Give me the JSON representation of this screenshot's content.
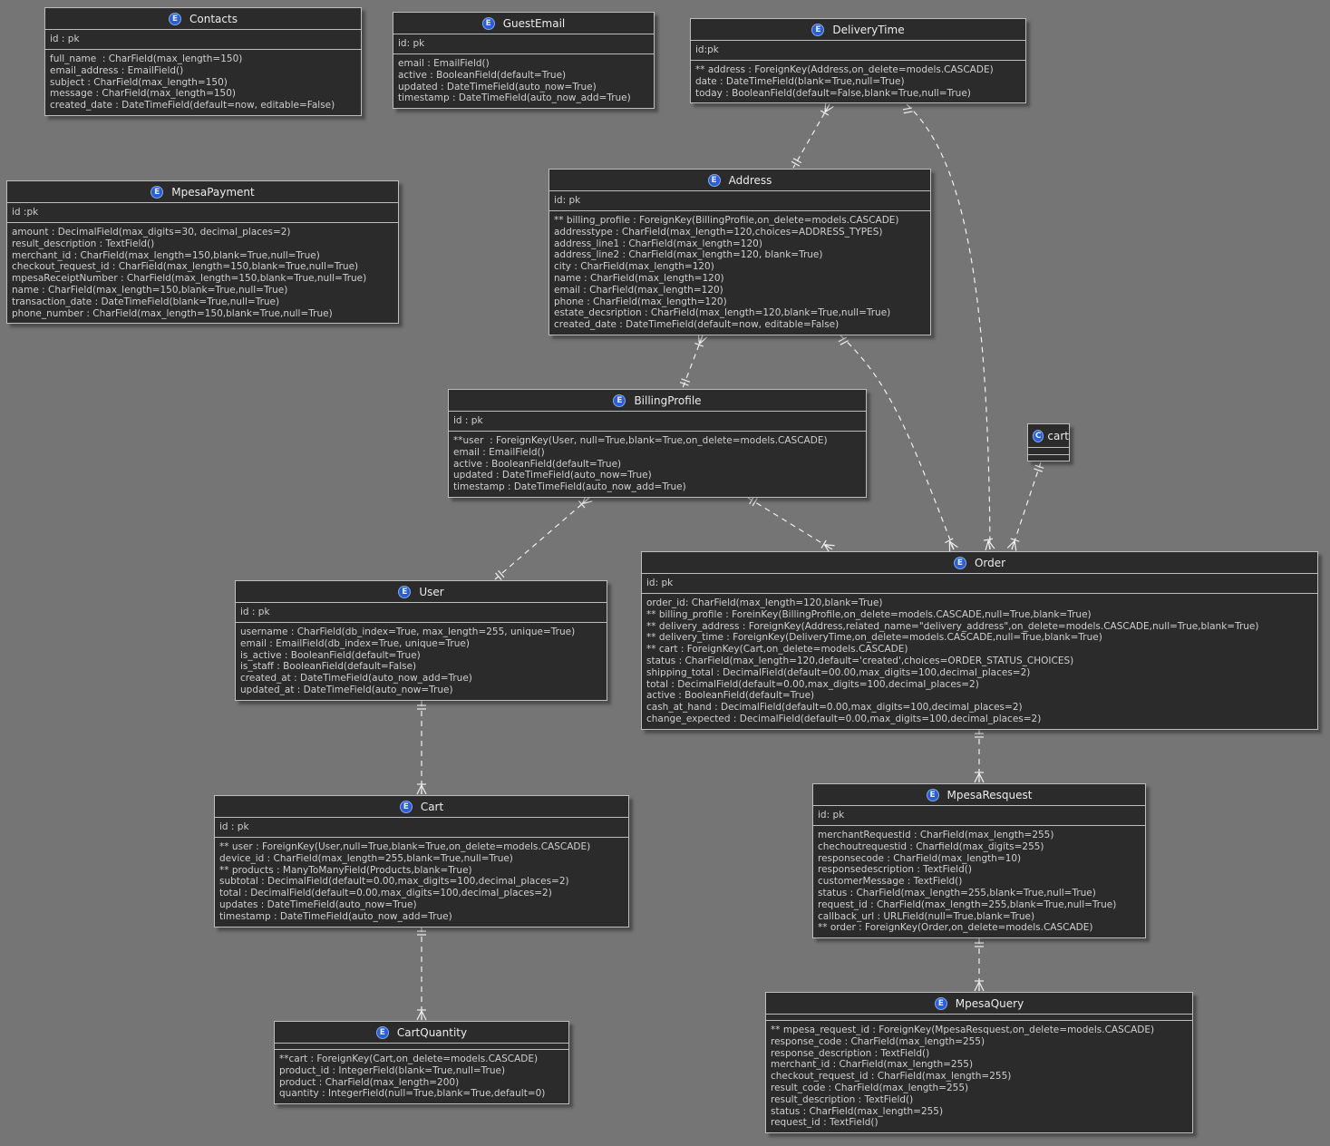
{
  "entities": {
    "contacts": {
      "name": "Contacts",
      "pk": "id : pk",
      "fields": [
        "full_name  : CharField(max_length=150)",
        "email_address : EmailField()",
        "subject : CharField(max_length=150)",
        "message : CharField(max_length=150)",
        "created_date : DateTimeField(default=now, editable=False)"
      ]
    },
    "guestemail": {
      "name": "GuestEmail",
      "pk": "id: pk",
      "fields": [
        "email : EmailField()",
        "active : BooleanField(default=True)",
        "updated : DateTimeField(auto_now=True)",
        "timestamp : DateTimeField(auto_now_add=True)"
      ]
    },
    "deliverytime": {
      "name": "DeliveryTime",
      "pk": "id:pk",
      "fields": [
        "** address : ForeignKey(Address,on_delete=models.CASCADE)",
        "date : DateTimeField(blank=True,null=True)",
        "today : BooleanField(default=False,blank=True,null=True)"
      ]
    },
    "mpesapayment": {
      "name": "MpesaPayment",
      "pk": "id :pk",
      "fields": [
        "amount : DecimalField(max_digits=30, decimal_places=2)",
        "result_description : TextField()",
        "merchant_id : CharField(max_length=150,blank=True,null=True)",
        "checkout_request_id : CharField(max_length=150,blank=True,null=True)",
        "mpesaReceiptNumber : CharField(max_length=150,blank=True,null=True)",
        "name : CharField(max_length=150,blank=True,null=True)",
        "transaction_date : DateTimeField(blank=True,null=True)",
        "phone_number : CharField(max_length=150,blank=True,null=True)"
      ]
    },
    "address": {
      "name": "Address",
      "pk": "id: pk",
      "fields": [
        "** billing_profile : ForeignKey(BillingProfile,on_delete=models.CASCADE)",
        "addresstype : CharField(max_length=120,choices=ADDRESS_TYPES)",
        "address_line1 : CharField(max_length=120)",
        "address_line2 : CharField(max_length=120, blank=True)",
        "city : CharField(max_length=120)",
        "name : CharField(max_length=120)",
        "email : CharField(max_length=120)",
        "phone : CharField(max_length=120)",
        "estate_decsription : CharField(max_length=120,blank=True,null=True)",
        "created_date : DateTimeField(default=now, editable=False)"
      ]
    },
    "billingprofile": {
      "name": "BillingProfile",
      "pk": "id : pk",
      "fields": [
        "**user  : ForeignKey(User, null=True,blank=True,on_delete=models.CASCADE)",
        "email : EmailField()",
        "active : BooleanField(default=True)",
        "updated : DateTimeField(auto_now=True)",
        "timestamp : DateTimeField(auto_now_add=True)"
      ]
    },
    "cartclass": {
      "name": "cart",
      "badge": "C"
    },
    "order": {
      "name": "Order",
      "pk": "id: pk",
      "fields": [
        "order_id: CharField(max_length=120,blank=True)",
        "** billing_profile : ForeinKey(BillingProfile,on_delete=models.CASCADE,null=True,blank=True)",
        "** delivery_address : ForeignKey(Address,related_name=\"delivery_address\",on_delete=models.CASCADE,null=True,blank=True)",
        "** delivery_time : ForeignKey(DeliveryTime,on_delete=models.CASCADE,null=True,blank=True)",
        "** cart : ForeignKey(Cart,on_delete=models.CASCADE)",
        "status : CharField(max_length=120,default='created',choices=ORDER_STATUS_CHOICES)",
        "shipping_total : DecimalField(default=00.00,max_digits=100,decimal_places=2)",
        "total : DecimalField(default=0.00,max_digits=100,decimal_places=2)",
        "active : BooleanField(default=True)",
        "cash_at_hand : DecimalField(default=0.00,max_digits=100,decimal_places=2)",
        "change_expected : DecimalField(default=0.00,max_digits=100,decimal_places=2)"
      ]
    },
    "user": {
      "name": "User",
      "pk": "id : pk",
      "fields": [
        "username : CharField(db_index=True, max_length=255, unique=True)",
        "email : EmailField(db_index=True, unique=True)",
        "is_active : BooleanField(default=True)",
        "is_staff : BooleanField(default=False)",
        "created_at : DateTimeField(auto_now_add=True)",
        "updated_at : DateTimeField(auto_now=True)"
      ]
    },
    "cart": {
      "name": "Cart",
      "pk": "id : pk",
      "fields": [
        "** user : ForeignKey(User,null=True,blank=True,on_delete=models.CASCADE)",
        "device_id : CharField(max_length=255,blank=True,null=True)",
        "** products : ManyToManyField(Products,blank=True)",
        "subtotal : DecimalField(default=0.00,max_digits=100,decimal_places=2)",
        "total : DecimalField(default=0.00,max_digits=100,decimal_places=2)",
        "updates : DateTimeField(auto_now=True)",
        "timestamp : DateTimeField(auto_now_add=True)"
      ]
    },
    "mpesaresquest": {
      "name": "MpesaResquest",
      "pk": "id: pk",
      "fields": [
        "merchantRequestid : CharField(max_length=255)",
        "chechoutrequestid : Charfield(max_digits=255)",
        "responsecode : CharField(max_length=10)",
        "responsedescription : TextField()",
        "customerMessage : TextField()",
        "status : CharField(max_length=255,blank=True,null=True)",
        "request_id : CharField(max_length=255,blank=True,null=True)",
        "callback_url : URLField(null=True,blank=True)",
        "** order : ForeignKey(Order,on_delete=models.CASCADE)"
      ]
    },
    "cartquantity": {
      "name": "CartQuantity",
      "fields": [
        "**cart : ForeignKey(Cart,on_delete=models.CASCADE)",
        "product_id : IntegerField(blank=True,null=True)",
        "product : CharField(max_length=200)",
        "quantity : IntegerField(null=True,blank=True,default=0)"
      ]
    },
    "mpesaquery": {
      "name": "MpesaQuery",
      "fields": [
        "** mpesa_request_id : ForeignKey(MpesaResquest,on_delete=models.CASCADE)",
        "response_code : CharField(max_length=255)",
        "response_description : TextField()",
        "merchant_id : CharField(max_length=255)",
        "checkout_request_id : CharField(max_length=255)",
        "result_code : CharField(max_length=255)",
        "result_description : TextField()",
        "status : CharField(max_length=255)",
        "request_id : TextField()"
      ]
    }
  },
  "relationships": [
    {
      "from": "deliverytime",
      "to": "address",
      "from_end": "one-or-many",
      "to_end": "exactly-one"
    },
    {
      "from": "deliverytime",
      "to": "order",
      "from_end": "exactly-one",
      "to_end": "one-or-many"
    },
    {
      "from": "address",
      "to": "billingprofile",
      "from_end": "one-or-many",
      "to_end": "exactly-one"
    },
    {
      "from": "address",
      "to": "order",
      "from_end": "exactly-one",
      "to_end": "one-or-many"
    },
    {
      "from": "cartclass",
      "to": "order",
      "from_end": "exactly-one",
      "to_end": "one-or-many"
    },
    {
      "from": "billingprofile",
      "to": "user",
      "from_end": "one-or-many",
      "to_end": "exactly-one"
    },
    {
      "from": "billingprofile",
      "to": "order",
      "from_end": "exactly-one",
      "to_end": "one-or-many"
    },
    {
      "from": "user",
      "to": "cart",
      "from_end": "exactly-one",
      "to_end": "one-or-many"
    },
    {
      "from": "cart",
      "to": "cartquantity",
      "from_end": "exactly-one",
      "to_end": "one-or-many"
    },
    {
      "from": "order",
      "to": "mpesaresquest",
      "from_end": "exactly-one",
      "to_end": "one-or-many"
    },
    {
      "from": "mpesaresquest",
      "to": "mpesaquery",
      "from_end": "exactly-one",
      "to_end": "one-or-many"
    }
  ],
  "entity_badge": "E",
  "colors": {
    "background": "#757575",
    "entity_fill": "#2b2b2b",
    "border": "#bdbdbd",
    "text": "#cfcfcf",
    "badge": "#2a5fd3",
    "edge": "#f0f0f0"
  }
}
